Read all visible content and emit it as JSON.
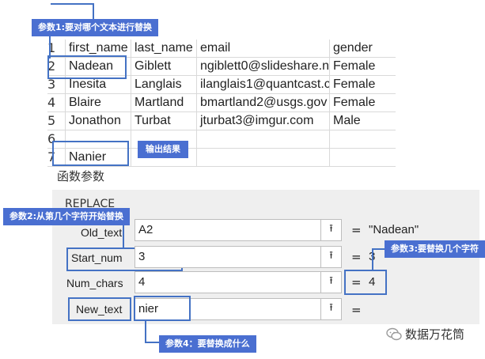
{
  "sheet": {
    "headers": [
      "first_name",
      "last_name",
      "email",
      "gender"
    ],
    "rows": [
      {
        "num": "1",
        "cells": [
          "first_name",
          "last_name",
          "email",
          "gender"
        ]
      },
      {
        "num": "2",
        "cells": [
          "Nadean",
          "Giblett",
          "ngiblett0@slideshare.n",
          "Female"
        ]
      },
      {
        "num": "3",
        "cells": [
          "Inesita",
          "Langlais",
          "ilanglais1@quantcast.c",
          "Female"
        ]
      },
      {
        "num": "4",
        "cells": [
          "Blaire",
          "Martland",
          "bmartland2@usgs.gov",
          "Female"
        ]
      },
      {
        "num": "5",
        "cells": [
          "Jonathon",
          "Turbat",
          "jturbat3@imgur.com",
          "Male"
        ]
      },
      {
        "num": "6",
        "cells": [
          "",
          "",
          "",
          ""
        ]
      },
      {
        "num": "7",
        "cells": [
          "Nanier",
          "",
          "",
          ""
        ]
      }
    ]
  },
  "annotations": {
    "param1": "参数1:要对哪个文本进行替换",
    "output": "输出结果",
    "param2": "参数2:从第几个字符开始替换",
    "param3": "参数3:要替换几个字符",
    "param4": "参数4：要替换成什么"
  },
  "dialog": {
    "title": "函数参数",
    "function_name": "REPLACE",
    "args": [
      {
        "label": "Old_text",
        "value": "A2",
        "result": "\"Nadean\""
      },
      {
        "label": "Start_num",
        "value": "3",
        "result": "3"
      },
      {
        "label": "Num_chars",
        "value": "4",
        "result": "4"
      },
      {
        "label": "New_text",
        "value": "nier",
        "result": ""
      }
    ],
    "equals": "=",
    "ref_button": "⭱"
  },
  "watermark": "数据万花筒",
  "colors": {
    "accent": "#4a6fd1",
    "outline": "#4472c4"
  }
}
